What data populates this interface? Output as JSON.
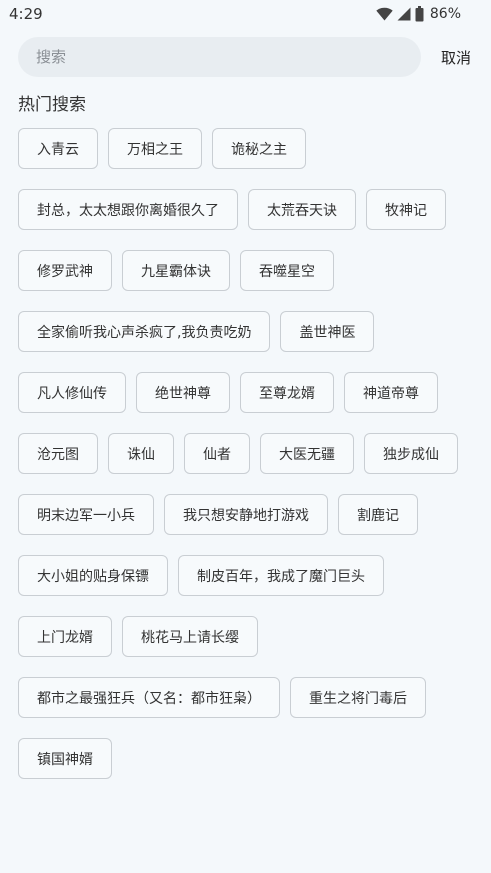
{
  "status": {
    "time": "4:29",
    "battery": "86%"
  },
  "search": {
    "placeholder": "搜索",
    "cancel_label": "取消"
  },
  "hot": {
    "title": "热门搜索",
    "rows": [
      [
        "入青云",
        "万相之王",
        "诡秘之主"
      ],
      [
        "封总，太太想跟你离婚很久了",
        "太荒吞天诀",
        "牧神记"
      ],
      [
        "修罗武神",
        "九星霸体诀",
        "吞噬星空"
      ],
      [
        "全家偷听我心声杀疯了,我负责吃奶",
        "盖世神医"
      ],
      [
        "凡人修仙传",
        "绝世神尊",
        "至尊龙婿",
        "神道帝尊"
      ],
      [
        "沧元图",
        "诛仙",
        "仙者",
        "大医无疆",
        "独步成仙"
      ],
      [
        "明末边军一小兵",
        "我只想安静地打游戏",
        "割鹿记"
      ],
      [
        "大小姐的贴身保镖",
        "制皮百年，我成了魔门巨头"
      ],
      [
        "上门龙婿",
        "桃花马上请长缨"
      ],
      [
        "都市之最强狂兵（又名：都市狂枭）",
        "重生之将门毒后"
      ],
      [
        "镇国神婿"
      ]
    ]
  }
}
